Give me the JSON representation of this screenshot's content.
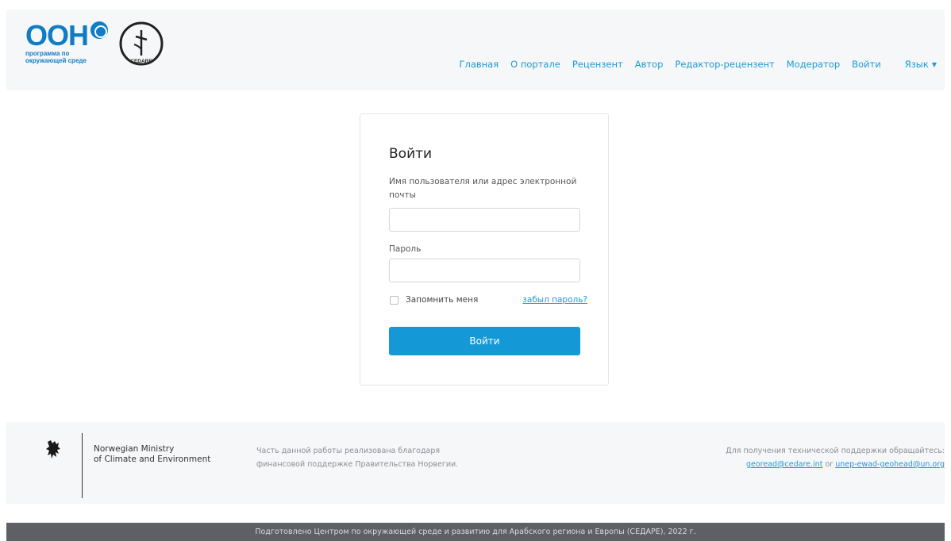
{
  "header": {
    "logo_text": "ООН",
    "logo_subtitle_line1": "программа по",
    "logo_subtitle_line2": "окружающей среде",
    "partner_logo_text": "CEDARE",
    "nav": [
      {
        "label": "Главная"
      },
      {
        "label": "О портале"
      },
      {
        "label": "Рецензент"
      },
      {
        "label": "Автор"
      },
      {
        "label": "Редактор-рецензент"
      },
      {
        "label": "Модератор"
      },
      {
        "label": "Войти"
      },
      {
        "label": "Язык"
      }
    ]
  },
  "login": {
    "title": "Войти",
    "username_label": "Имя пользователя или адрес электронной почты",
    "username_value": "",
    "password_label": "Пароль",
    "password_value": "",
    "remember_label": "Запомнить меня",
    "remember_checked": false,
    "forgot_label": "забыл пароль?",
    "submit_label": "Войти"
  },
  "footer": {
    "ministry_line1": "Norwegian Ministry",
    "ministry_line2": "of Climate and Environment",
    "support_text": "Часть данной работы реализована благодаря финансовой поддержке Правительства Норвегии.",
    "contact_text": "Для получения технической поддержки обращайтесь:",
    "contact_email1": "georead@cedare.int",
    "contact_or": "or",
    "contact_email2": "unep-ewad-geohead@un.org",
    "bottom_bar": "Подготовлено Центром по окружающей среде и развитию для Арабского региона и Европы (СЕДАРЕ), 2022 г."
  },
  "colors": {
    "accent": "#1499d6",
    "link": "#1b9bd7",
    "un_blue": "#0f7cc6",
    "footer_bar": "#5e6066"
  },
  "icons": {
    "un_emblem": "un-emblem-icon",
    "cedare_logo": "cedare-logo-icon",
    "lion": "norway-lion-icon",
    "caret": "chevron-down-icon"
  }
}
